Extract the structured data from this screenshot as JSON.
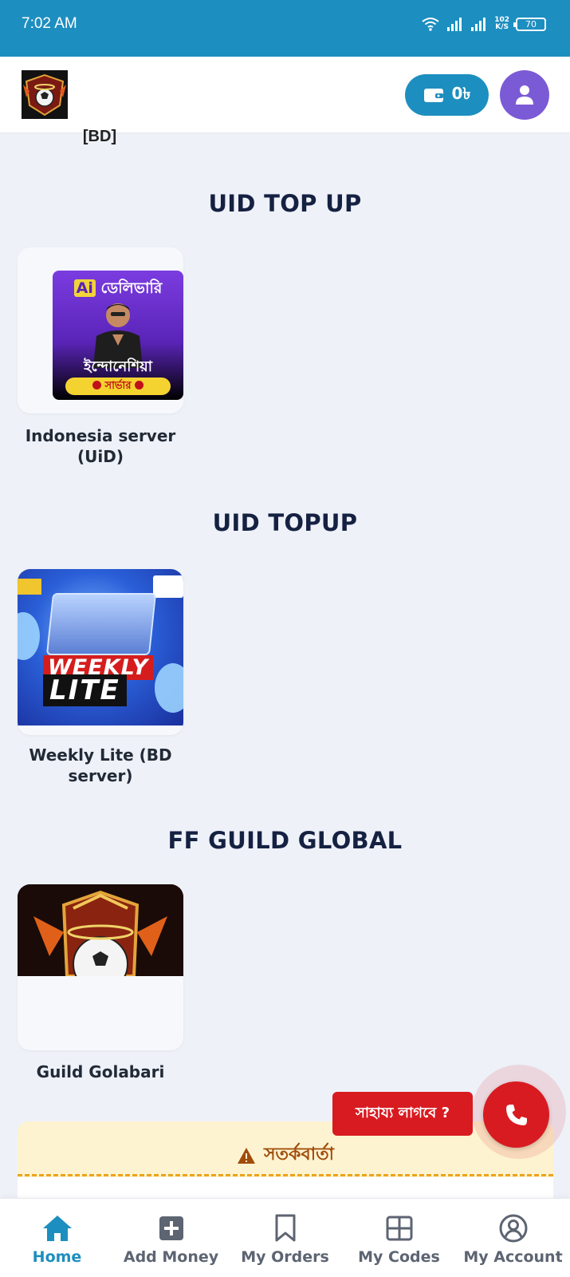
{
  "status_bar": {
    "time": "7:02 AM",
    "network_speed_value": "102",
    "network_speed_unit": "K/S",
    "battery": "70"
  },
  "header": {
    "wallet_balance": "0৳"
  },
  "partial_label": "[BD]",
  "sections": [
    {
      "title": "UID TOP UP",
      "product": {
        "name": "Indonesia server (UiD)",
        "thumb_top_tag": "Ai",
        "thumb_top": "ডেলিভারি",
        "thumb_bottom": "ইন্দোনেশিয়া",
        "thumb_server": "সার্ভার"
      }
    },
    {
      "title": "UID TOPUP",
      "product": {
        "name": "Weekly Lite (BD server)",
        "thumb_line1": "WEEKLY",
        "thumb_line2": "LITE"
      }
    },
    {
      "title": "FF GUILD GLOBAL",
      "product": {
        "name": "Guild Golabari"
      }
    }
  ],
  "help_bubble": "সাহায্য লাগবে ?",
  "notice": {
    "title": "সতর্কবার্তা"
  },
  "bottom_nav": [
    {
      "label": "Home",
      "icon": "home-icon",
      "active": true
    },
    {
      "label": "Add Money",
      "icon": "plus-square-icon",
      "active": false
    },
    {
      "label": "My Orders",
      "icon": "bookmark-icon",
      "active": false
    },
    {
      "label": "My Codes",
      "icon": "grid-icon",
      "active": false
    },
    {
      "label": "My Account",
      "icon": "user-circle-icon",
      "active": false
    }
  ],
  "colors": {
    "primary": "#1d8ec0",
    "avatar": "#7b5ad6",
    "alert_red": "#d81b21",
    "page_bg": "#eef1f8",
    "notice_bg": "#fdf3d0",
    "notice_text": "#a04b09"
  }
}
